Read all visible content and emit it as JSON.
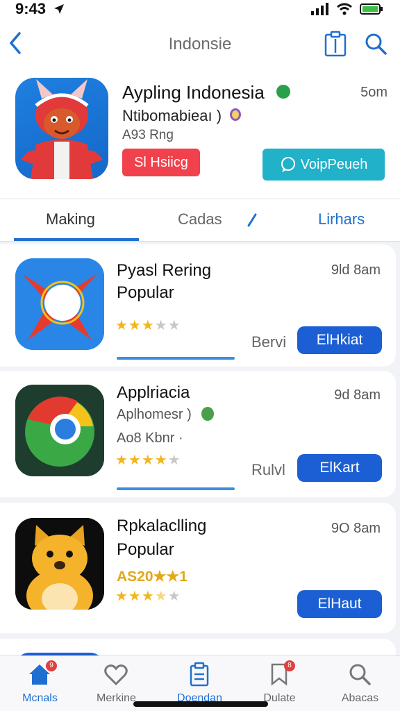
{
  "status": {
    "time": "9:43"
  },
  "nav": {
    "title": "Indonsie"
  },
  "hero": {
    "title": "Aypling Indonesia",
    "subtitle": "Ntibomabieaı )",
    "rating": "A93 Rng",
    "time": "5om",
    "red_button": "Sl Hsiicg",
    "teal_button": "VoipPeueh"
  },
  "tabs": [
    {
      "label": "Making"
    },
    {
      "label": "Cadas"
    },
    {
      "label": "Lirhars"
    }
  ],
  "apps": [
    {
      "title": "Pyasl Rering",
      "title2": "Popular",
      "time": "9ld 8am",
      "stars": 3,
      "label": "Bervi",
      "button": "ElHkiat"
    },
    {
      "title": "Applriacia",
      "subtitle": "Aplhomesr )",
      "subtitle2": "Ao8 Kbnr ·",
      "time": "9d 8am",
      "stars": 4,
      "label": "Rulvl",
      "button": "ElKart"
    },
    {
      "title": "Rpkalaclling",
      "title2": "Popular",
      "gold_text": "AS20★★1",
      "time": "9O 8am",
      "stars": 3.5,
      "button": "ElHaut"
    }
  ],
  "tabbar": [
    {
      "label": "Mcnals",
      "icon": "home-icon",
      "badge": "9"
    },
    {
      "label": "Merkine",
      "icon": "heart-icon"
    },
    {
      "label": "Doendan",
      "icon": "clipboard-icon"
    },
    {
      "label": "Dulate",
      "icon": "bookmark-icon",
      "badge": "8"
    },
    {
      "label": "Abacas",
      "icon": "search-icon"
    }
  ],
  "colors": {
    "accent": "#1f6fd0",
    "button_blue": "#1c5fd4",
    "red": "#f0414c",
    "teal": "#21b1c9",
    "star": "#f2b51b"
  }
}
